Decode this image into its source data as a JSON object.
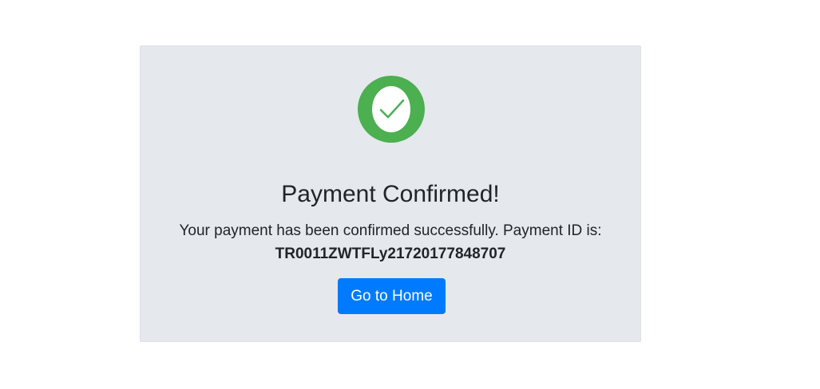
{
  "confirmation": {
    "icon": "check-circle-icon",
    "icon_color": "#4caf50",
    "title": "Payment Confirmed!",
    "message": "Your payment has been confirmed successfully. Payment ID is:",
    "payment_id": "TR0011ZWTFLy21720177848707"
  },
  "actions": {
    "home_label": "Go to Home",
    "button_color": "#007bff"
  }
}
